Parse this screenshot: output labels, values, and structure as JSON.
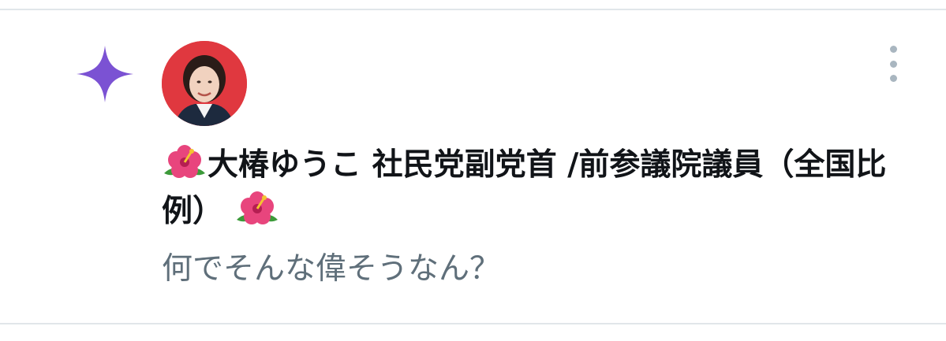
{
  "notification": {
    "icon": "sparkle-icon",
    "accent_color": "#7b52d3",
    "avatar_bg": "#e0383f",
    "author_name": "大椿ゆうこ 社民党副党首 /前参議院議員（全国比例）",
    "name_emoji": "hibiscus-icon",
    "message": "何でそんな偉そうなん？",
    "menu_icon": "more-vertical-icon"
  }
}
